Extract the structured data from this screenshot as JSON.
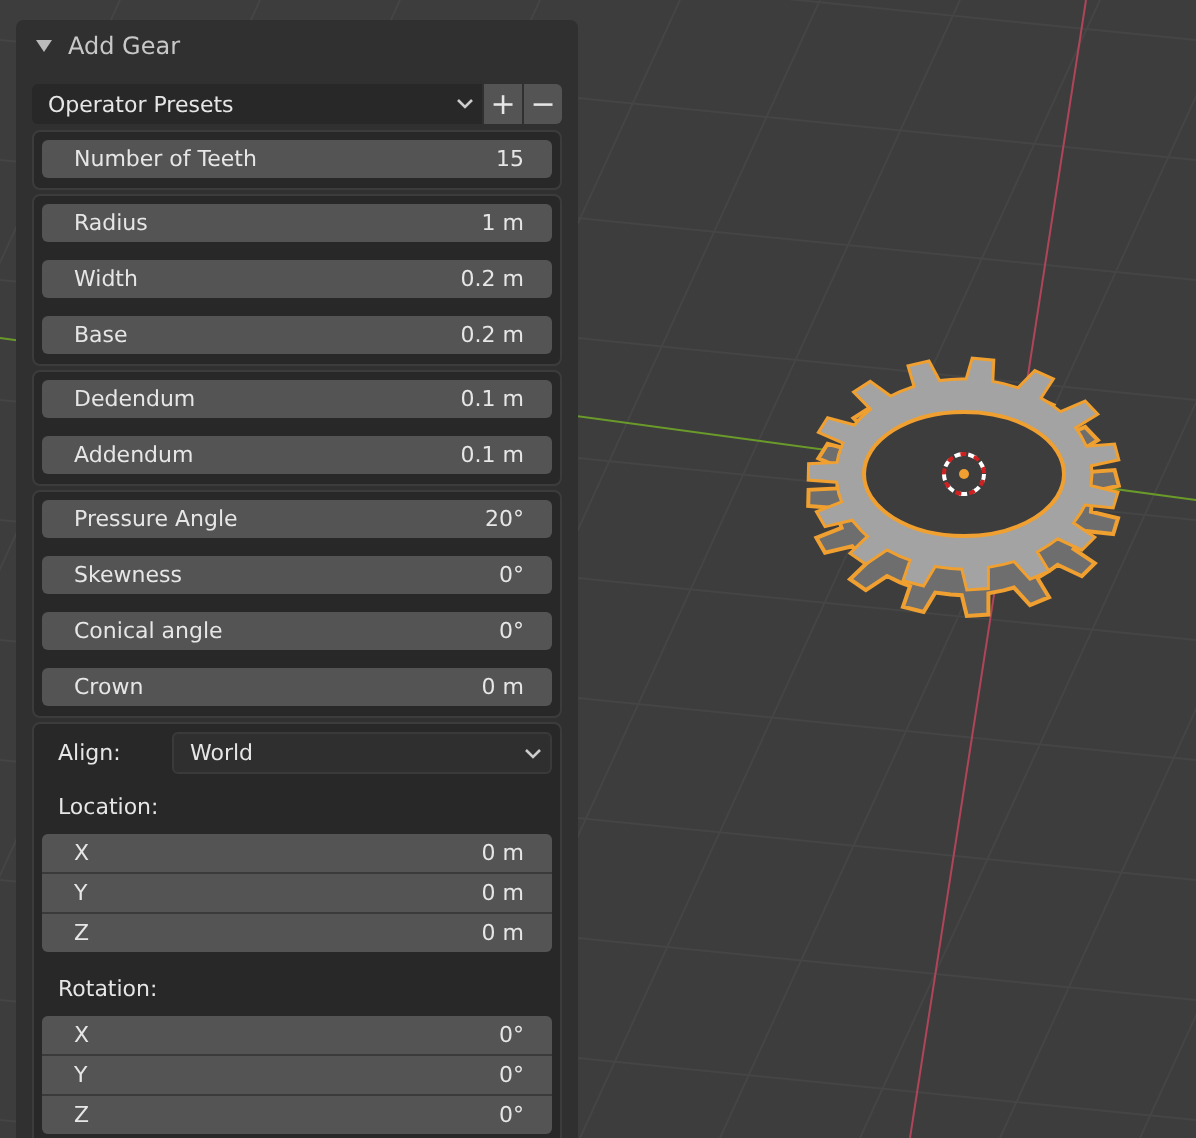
{
  "panel": {
    "title": "Add Gear",
    "expanded": true
  },
  "presets": {
    "label": "Operator Presets",
    "add": "+",
    "remove": "−"
  },
  "groups": [
    {
      "fields": [
        {
          "label": "Number of Teeth",
          "value": "15"
        }
      ]
    },
    {
      "fields": [
        {
          "label": "Radius",
          "value": "1 m"
        },
        {
          "label": "Width",
          "value": "0.2 m"
        },
        {
          "label": "Base",
          "value": "0.2 m"
        }
      ]
    },
    {
      "fields": [
        {
          "label": "Dedendum",
          "value": "0.1 m"
        },
        {
          "label": "Addendum",
          "value": "0.1 m"
        }
      ]
    },
    {
      "fields": [
        {
          "label": "Pressure Angle",
          "value": "20°"
        },
        {
          "label": "Skewness",
          "value": "0°"
        },
        {
          "label": "Conical angle",
          "value": "0°"
        },
        {
          "label": "Crown",
          "value": "0 m"
        }
      ]
    }
  ],
  "align": {
    "label": "Align:",
    "value": "World"
  },
  "vectors": [
    {
      "label": "Location:",
      "fields": [
        {
          "label": "X",
          "value": "0 m"
        },
        {
          "label": "Y",
          "value": "0 m"
        },
        {
          "label": "Z",
          "value": "0 m"
        }
      ]
    },
    {
      "label": "Rotation:",
      "fields": [
        {
          "label": "X",
          "value": "0°"
        },
        {
          "label": "Y",
          "value": "0°"
        },
        {
          "label": "Z",
          "value": "0°"
        }
      ]
    }
  ]
}
